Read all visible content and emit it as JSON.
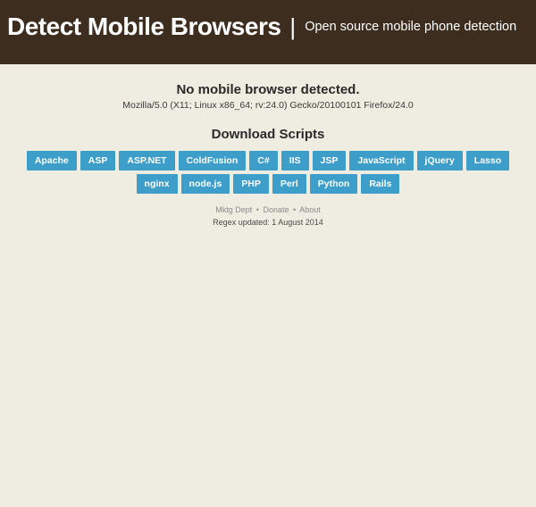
{
  "header": {
    "title": "Detect Mobile Browsers",
    "divider": "|",
    "tagline": "Open source mobile phone detection"
  },
  "detect": {
    "heading": "No mobile browser detected.",
    "userAgent": "Mozilla/5.0 (X11; Linux x86_64; rv:24.0) Gecko/20100101 Firefox/24.0"
  },
  "download": {
    "heading": "Download Scripts",
    "buttons": [
      "Apache",
      "ASP",
      "ASP.NET",
      "ColdFusion",
      "C#",
      "IIS",
      "JSP",
      "JavaScript",
      "jQuery",
      "Lasso",
      "nginx",
      "node.js",
      "PHP",
      "Perl",
      "Python",
      "Rails"
    ]
  },
  "footer": {
    "link1": "Mktg Dept",
    "sep": "•",
    "link2": "Donate",
    "link3": "About",
    "regexLabel": "Regex updated:",
    "regexDate": "1 August 2014"
  }
}
